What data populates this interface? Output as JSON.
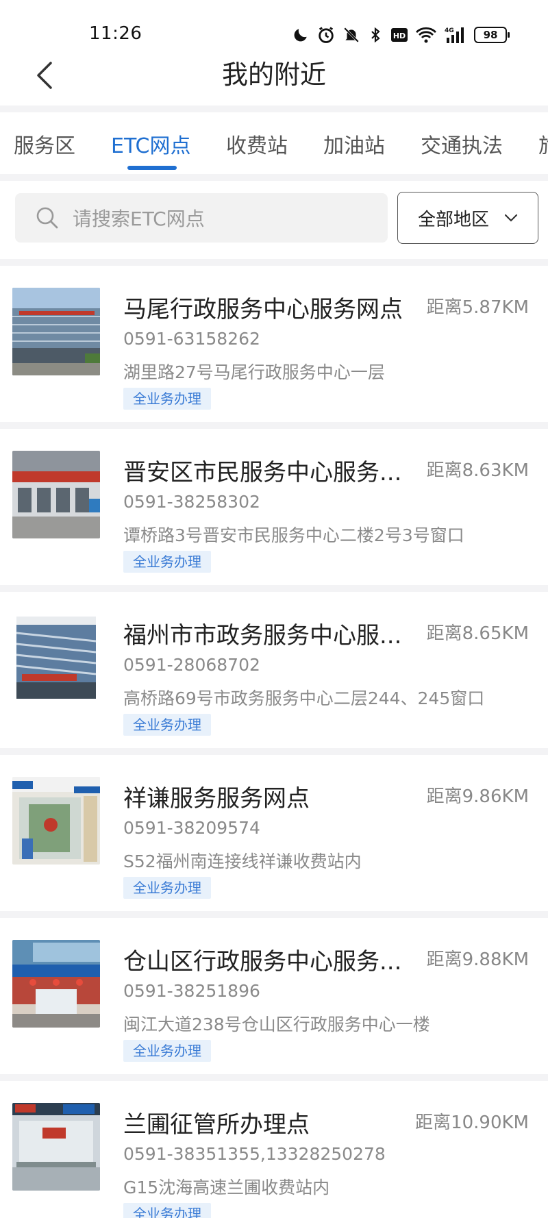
{
  "status_bar": {
    "time": "11:26",
    "network_label": "4G",
    "hd_label": "HD",
    "battery": "98"
  },
  "header": {
    "title": "我的附近"
  },
  "tabs": [
    {
      "label": "服务区",
      "active": false
    },
    {
      "label": "ETC网点",
      "active": true
    },
    {
      "label": "收费站",
      "active": false
    },
    {
      "label": "加油站",
      "active": false
    },
    {
      "label": "交通执法",
      "active": false
    },
    {
      "label": "旅",
      "active": false
    }
  ],
  "search": {
    "placeholder": "请搜索ETC网点",
    "region_label": "全部地区"
  },
  "items": [
    {
      "name": "马尾行政服务中心服务网点",
      "distance": "距离5.87KM",
      "phone": "0591-63158262",
      "address": "湖里路27号马尾行政服务中心一层",
      "tag": "全业务办理"
    },
    {
      "name": "晋安区市民服务中心服务...",
      "distance": "距离8.63KM",
      "phone": "0591-38258302",
      "address": "谭桥路3号晋安市民服务中心二楼2号3号窗口",
      "tag": "全业务办理"
    },
    {
      "name": "福州市市政务服务中心服...",
      "distance": "距离8.65KM",
      "phone": "0591-28068702",
      "address": "高桥路69号市政务服务中心二层244、245窗口",
      "tag": "全业务办理"
    },
    {
      "name": "祥谦服务服务网点",
      "distance": "距离9.86KM",
      "phone": "0591-38209574",
      "address": "S52福州南连接线祥谦收费站内",
      "tag": "全业务办理"
    },
    {
      "name": "仓山区行政服务中心服务...",
      "distance": "距离9.88KM",
      "phone": "0591-38251896",
      "address": "闽江大道238号仓山区行政服务中心一楼",
      "tag": "全业务办理"
    },
    {
      "name": "兰圃征管所办理点",
      "distance": "距离10.90KM",
      "phone": "0591-38351355,13328250278",
      "address": "G15沈海高速兰圃收费站内",
      "tag": "全业务办理"
    }
  ]
}
